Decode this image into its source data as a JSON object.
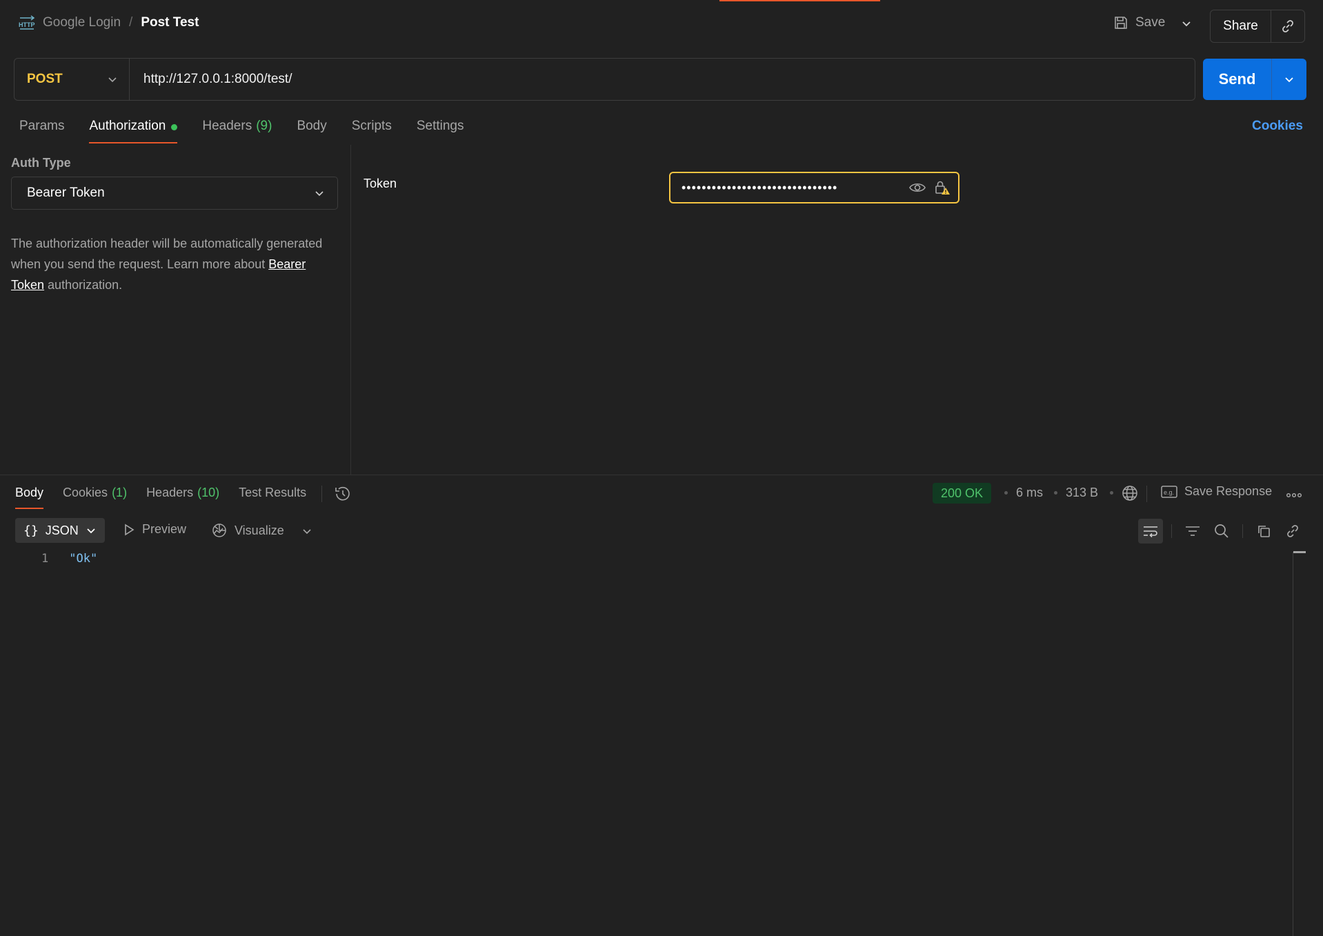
{
  "breadcrumb": {
    "parent": "Google Login",
    "separator": "/",
    "current": "Post Test"
  },
  "toolbar": {
    "save_label": "Save",
    "share_label": "Share"
  },
  "request": {
    "method": "POST",
    "url": "http://127.0.0.1:8000/test/",
    "send_label": "Send"
  },
  "request_tabs": [
    {
      "label": "Params"
    },
    {
      "label": "Authorization",
      "active": true,
      "indicator": true
    },
    {
      "label": "Headers",
      "count": "(9)"
    },
    {
      "label": "Body"
    },
    {
      "label": "Scripts"
    },
    {
      "label": "Settings"
    }
  ],
  "cookies_label": "Cookies",
  "auth": {
    "type_label": "Auth Type",
    "type_value": "Bearer Token",
    "desc_1": "The authorization header will be automatically generated when you send the request. Learn more about ",
    "desc_link": "Bearer Token",
    "desc_2": " authorization.",
    "token_label": "Token",
    "token_masked": "•••••••••••••••••••••••••••••••"
  },
  "response_tabs": [
    {
      "label": "Body",
      "active": true
    },
    {
      "label": "Cookies",
      "count": "(1)"
    },
    {
      "label": "Headers",
      "count": "(10)"
    },
    {
      "label": "Test Results"
    }
  ],
  "response_meta": {
    "status": "200 OK",
    "time": "6 ms",
    "size": "313 B",
    "save_response_label": "Save Response"
  },
  "response_toolbar": {
    "format_braces": "{}",
    "format_label": "JSON",
    "preview_label": "Preview",
    "visualize_label": "Visualize"
  },
  "response_body": {
    "line_number": "1",
    "content": "\"Ok\""
  },
  "colors": {
    "accent_orange": "#e8562a",
    "method_yellow": "#f5c542",
    "send_blue": "#0b6fe0",
    "success_green": "#4fc36b",
    "link_blue": "#4b9cf5"
  }
}
